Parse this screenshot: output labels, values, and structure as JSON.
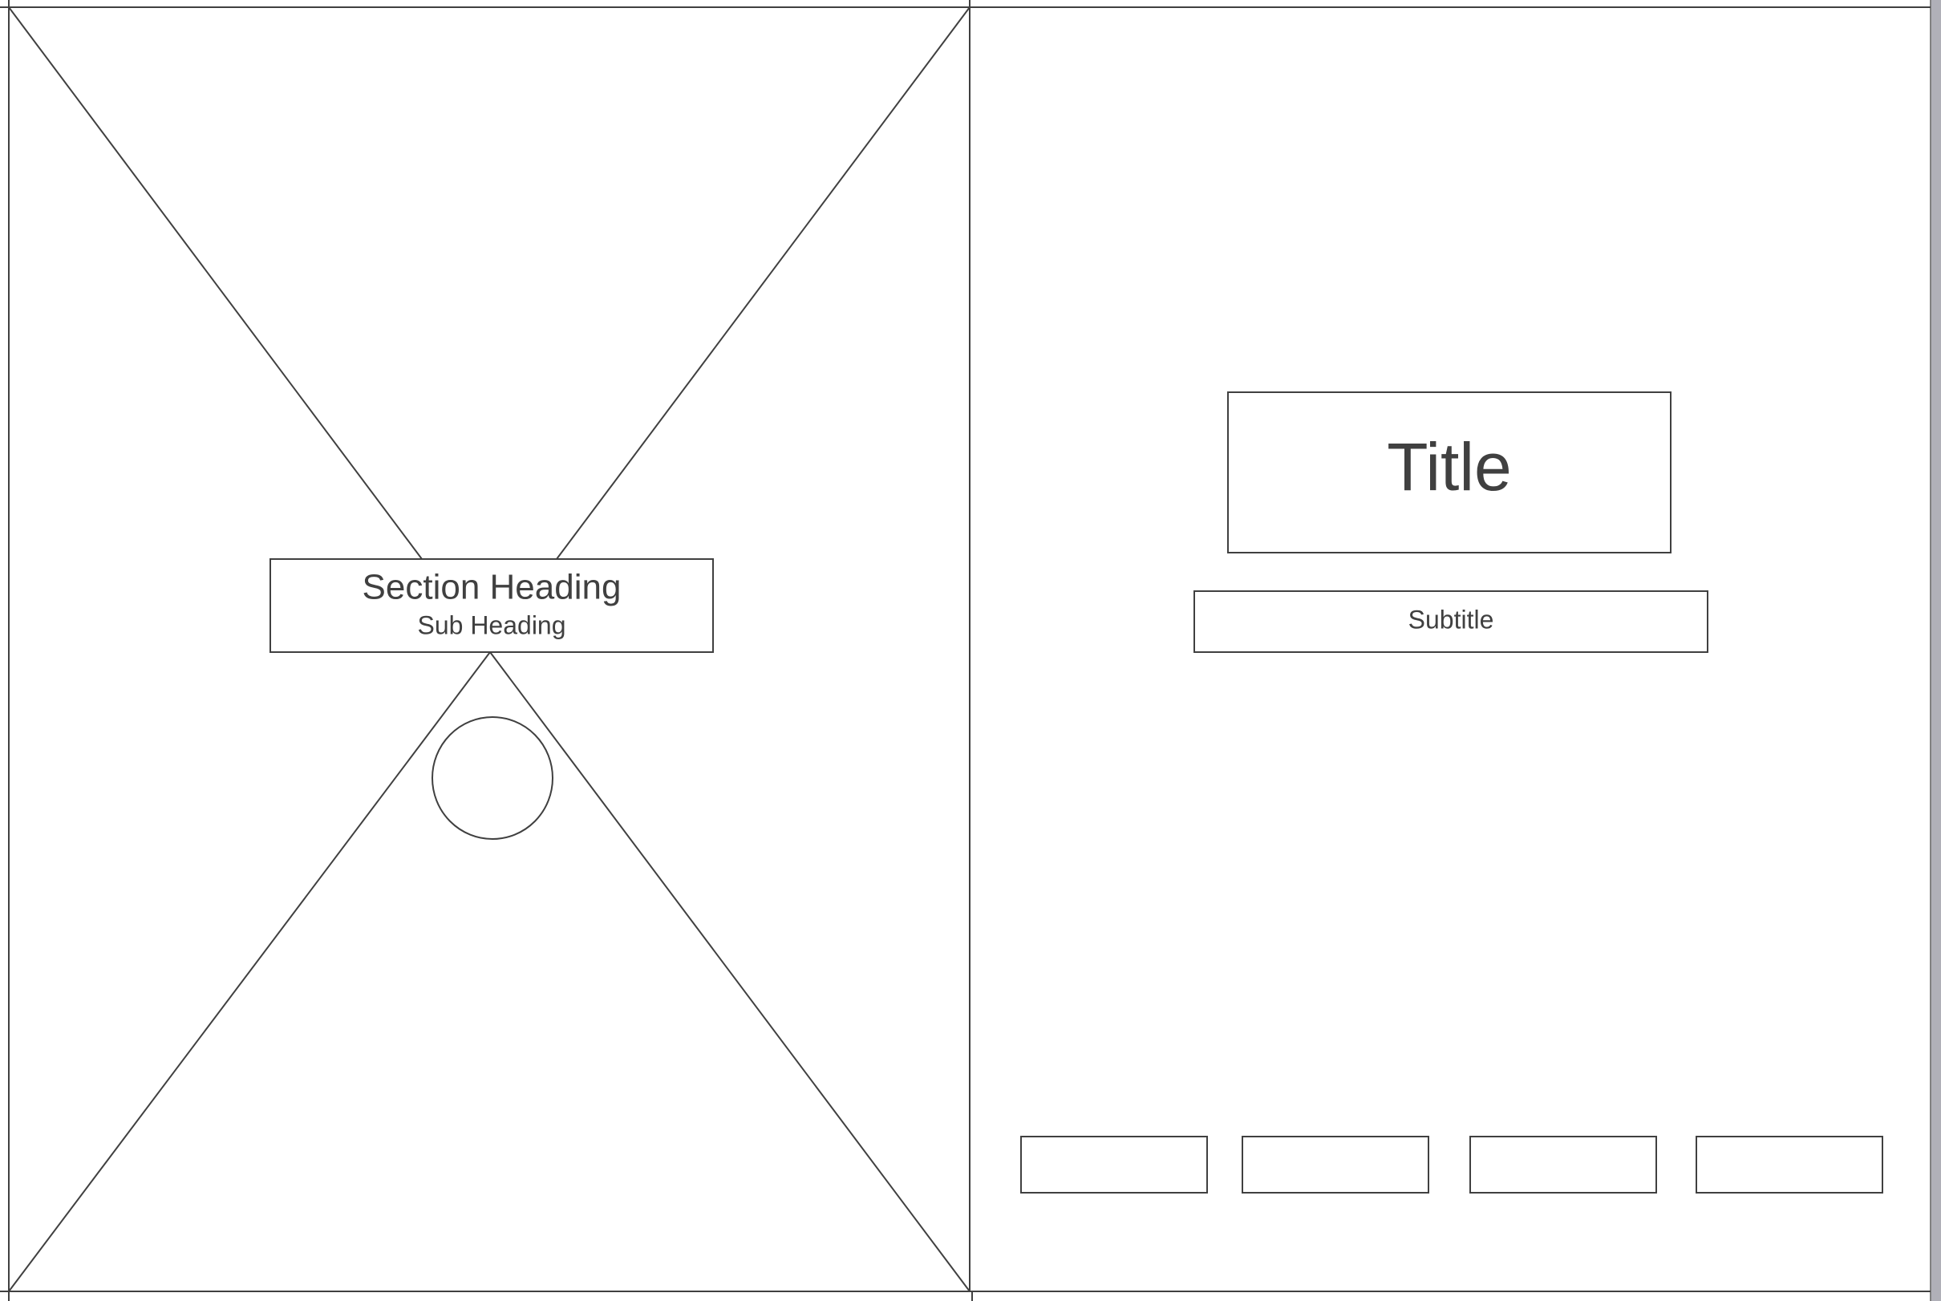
{
  "left_panel": {
    "placeholder": "image-placeholder",
    "section_heading": "Section Heading",
    "sub_heading": "Sub Heading"
  },
  "right_panel": {
    "title": "Title",
    "subtitle": "Subtitle",
    "buttons": [
      "",
      "",
      "",
      ""
    ]
  },
  "colors": {
    "stroke": "#404040",
    "background": "#ffffff",
    "page_edge": "#b0b0b8"
  }
}
